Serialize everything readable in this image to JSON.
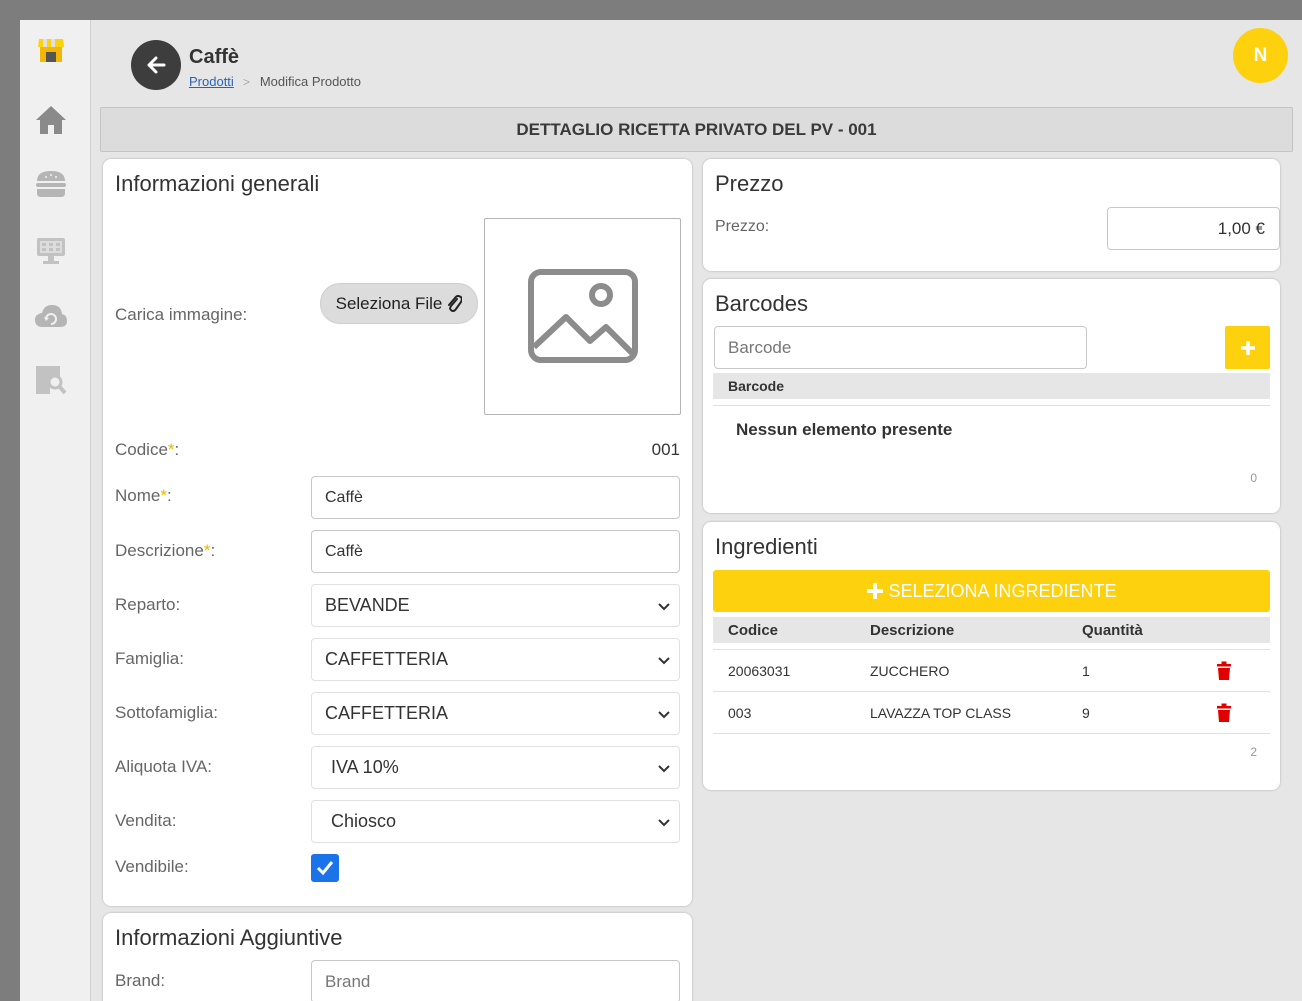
{
  "sidebar": {
    "items": [
      {
        "name": "logo",
        "icon": "shop-awning-icon"
      },
      {
        "name": "home",
        "icon": "home-icon"
      },
      {
        "name": "products",
        "icon": "burger-icon"
      },
      {
        "name": "pos",
        "icon": "cash-register-icon"
      },
      {
        "name": "cloud",
        "icon": "cloud-sync-icon"
      },
      {
        "name": "reports",
        "icon": "document-search-icon"
      }
    ]
  },
  "header": {
    "title": "Caffè",
    "breadcrumb_link": "Prodotti",
    "breadcrumb_current": "Modifica Prodotto",
    "avatar_initial": "N"
  },
  "banner": "DETTAGLIO RICETTA PRIVATO DEL PV - 001",
  "general": {
    "title": "Informazioni generali",
    "image_label": "Carica immagine:",
    "file_button": "Seleziona File",
    "code_label": "Codice",
    "code_value": "001",
    "name_label": "Nome",
    "name_value": "Caffè",
    "desc_label": "Descrizione",
    "desc_value": "Caffè",
    "reparto_label": "Reparto:",
    "reparto_value": "BEVANDE",
    "famiglia_label": "Famiglia:",
    "famiglia_value": "CAFFETTERIA",
    "sottofamiglia_label": "Sottofamiglia:",
    "sottofamiglia_value": "CAFFETTERIA",
    "iva_label": "Aliquota IVA:",
    "iva_value": "IVA 10%",
    "vendita_label": "Vendita:",
    "vendita_value": "Chiosco",
    "vendibile_label": "Vendibile:",
    "vendibile_checked": true,
    "required_mark": "*",
    "colon": ":"
  },
  "additional": {
    "title": "Informazioni Aggiuntive",
    "brand_label": "Brand:",
    "brand_placeholder": "Brand"
  },
  "price": {
    "title": "Prezzo",
    "label": "Prezzo:",
    "value": "1,00 €"
  },
  "barcodes": {
    "title": "Barcodes",
    "placeholder": "Barcode",
    "column": "Barcode",
    "empty": "Nessun elemento presente",
    "count": "0"
  },
  "ingredients": {
    "title": "Ingredienti",
    "select_button": "SELEZIONA INGREDIENTE",
    "columns": [
      "Codice",
      "Descrizione",
      "Quantità"
    ],
    "rows": [
      {
        "code": "20063031",
        "description": "ZUCCHERO",
        "qty": "1"
      },
      {
        "code": "003",
        "description": "LAVAZZA TOP CLASS",
        "qty": "9"
      }
    ],
    "count": "2"
  },
  "colors": {
    "accent": "#fdd10d",
    "checkbox": "#1a73e8",
    "delete": "#e00000",
    "back_button": "#3d3d3d"
  }
}
